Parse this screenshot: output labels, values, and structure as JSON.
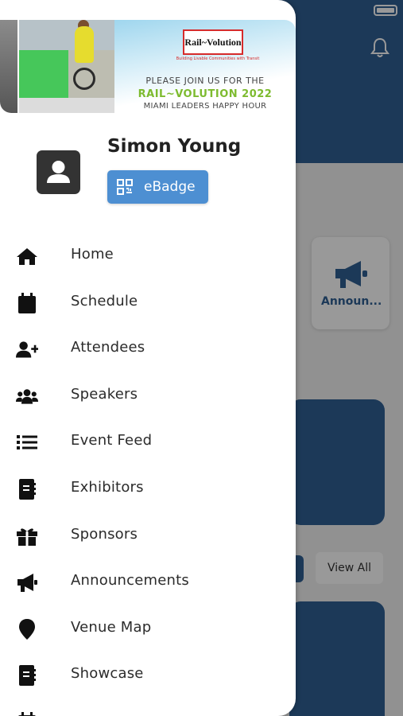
{
  "status_bar": {
    "battery_icon": "battery-icon"
  },
  "background": {
    "header_color": "#2f5f93",
    "tile_label": "Announ...",
    "view_all_label": "View All",
    "bell_icon": "bell-icon"
  },
  "drawer": {
    "banner": {
      "logo_text": "Rail~Volution",
      "tagline": "Building Livable Communities with Transit",
      "line1": "PLEASE JOIN US FOR THE",
      "line2": "RAIL~VOLUTION 2022",
      "line3": "MIAMI LEADERS HAPPY HOUR"
    },
    "profile": {
      "name": "Simon Young",
      "badge_label": "eBadge",
      "badge_color": "#4d8fd2"
    },
    "menu": [
      {
        "label": "Home",
        "icon": "home-icon"
      },
      {
        "label": "Schedule",
        "icon": "calendar-icon"
      },
      {
        "label": "Attendees",
        "icon": "user-plus-icon"
      },
      {
        "label": "Speakers",
        "icon": "users-icon"
      },
      {
        "label": "Event Feed",
        "icon": "list-icon"
      },
      {
        "label": "Exhibitors",
        "icon": "address-book-icon"
      },
      {
        "label": "Sponsors",
        "icon": "gift-icon"
      },
      {
        "label": "Announcements",
        "icon": "megaphone-icon"
      },
      {
        "label": "Venue Map",
        "icon": "map-pin-icon"
      },
      {
        "label": "Showcase",
        "icon": "book-icon"
      }
    ]
  }
}
